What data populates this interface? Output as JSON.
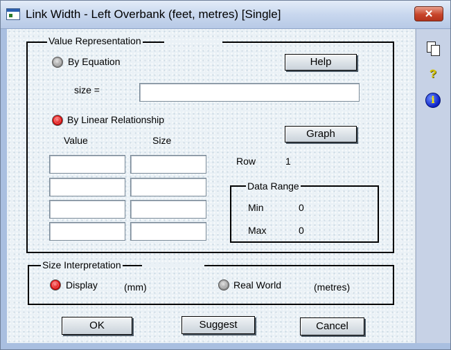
{
  "window": {
    "title": "Link Width - Left Overbank (feet, metres) [Single]",
    "close_label": "✕"
  },
  "value_representation": {
    "legend": "Value Representation",
    "by_equation_label": "By Equation",
    "by_equation_selected": false,
    "help_label": "Help",
    "size_label": "size =",
    "size_value": "",
    "by_linear_label": "By Linear Relationship",
    "by_linear_selected": true,
    "graph_label": "Graph",
    "col_value": "Value",
    "col_size": "Size",
    "rows": [
      {
        "value": "",
        "size": ""
      },
      {
        "value": "",
        "size": ""
      },
      {
        "value": "",
        "size": ""
      },
      {
        "value": "",
        "size": ""
      }
    ],
    "row_label": "Row",
    "row_value": "1",
    "data_range": {
      "legend": "Data Range",
      "min_label": "Min",
      "min_value": "0",
      "max_label": "Max",
      "max_value": "0"
    }
  },
  "size_interpretation": {
    "legend": "Size Interpretation",
    "display_label": "Display",
    "display_unit": "(mm)",
    "display_selected": true,
    "real_world_label": "Real World",
    "real_world_unit": "(metres)",
    "real_world_selected": false
  },
  "buttons": {
    "ok": "OK",
    "suggest": "Suggest",
    "cancel": "Cancel"
  },
  "side_icons": [
    "copy-icon",
    "help-question-icon",
    "info-icon"
  ]
}
